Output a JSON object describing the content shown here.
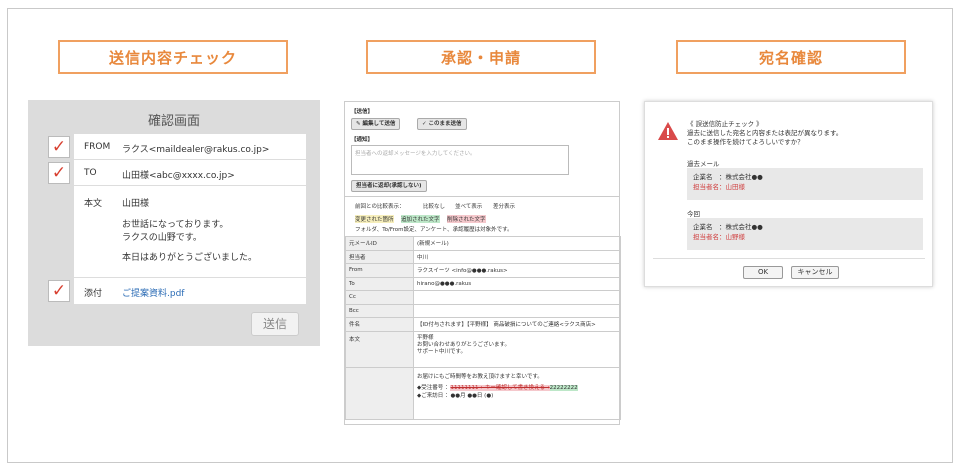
{
  "headers": {
    "send_check": "送信内容チェック",
    "approval": "承認・申請",
    "address": "宛名確認"
  },
  "confirm": {
    "title": "確認画面",
    "from_label": "FROM",
    "from_value": "ラクス<maildealer@rakus.co.jp>",
    "to_label": "TO",
    "to_value": "山田様<abc@xxxx.co.jp>",
    "body_label": "本文",
    "body_lines": [
      "山田様",
      "お世話になっております。",
      "ラクスの山野です。",
      "本日はありがとうございました。"
    ],
    "attach_label": "添付",
    "attach_value": "ご提案資料.pdf",
    "send_button": "送信",
    "check_mark": "✓"
  },
  "approval": {
    "section_send": "【送信】",
    "btn_edit": "✎ 編集して送信",
    "btn_send_as_is": "✓ このまま送信",
    "section_notify": "【通知】",
    "notify_placeholder": "担当者への返却メッセージを入力してください。",
    "btn_return": "担当者に返却(承認しない)",
    "compare_label": "前回との比較表示：",
    "compare_opts": [
      "比較なし",
      "並べて表示",
      "差分表示"
    ],
    "legend": [
      "変更された箇所",
      "追加された文字",
      "削除された文字"
    ],
    "legend_note": "フォルダ、To/From設定、アンケート、承認履歴は対象外です。",
    "rows": [
      {
        "k": "元メールID",
        "v": "(新規メール)"
      },
      {
        "k": "担当者",
        "v": "中川"
      },
      {
        "k": "From",
        "v": "ラクスイーツ <info@●●●.rakus>"
      },
      {
        "k": "To",
        "v": "hirano@●●●.rakus"
      },
      {
        "k": "Cc",
        "v": ""
      },
      {
        "k": "Bcc",
        "v": ""
      },
      {
        "k": "件名",
        "v": "【ID付与されます】【平野様】 商品破損についてのご連絡<ラクス商店>"
      }
    ],
    "body_key": "本文",
    "body_lines": [
      "平野様",
      "お問い合わせありがとうございます。",
      "サポート中川です。"
    ],
    "body2_lines": [
      "お届けにもご時間等をお教え頂けますと幸いです。"
    ],
    "order_label": "◆受注番号 ：",
    "order_struck": "11111111 ←キー確認して書き換える→",
    "order_new": "22222222",
    "date_line": "◆ご来訪日 ：●●月 ●●日 (●)"
  },
  "address": {
    "heading": "《 誤送信防止チェック 》",
    "msg1": "過去に送信した宛名と内容または表記が異なります。",
    "msg2": "このまま操作を続けてよろしいですか？",
    "past_label": "過去メール",
    "past_company": "企業名　：株式会社●●",
    "past_person": "担当者名：山田様",
    "now_label": "今回",
    "now_company": "企業名　：株式会社●●",
    "now_person": "担当者名：山野様",
    "ok": "OK",
    "cancel": "キャンセル",
    "warning_icon": "warning-icon"
  }
}
